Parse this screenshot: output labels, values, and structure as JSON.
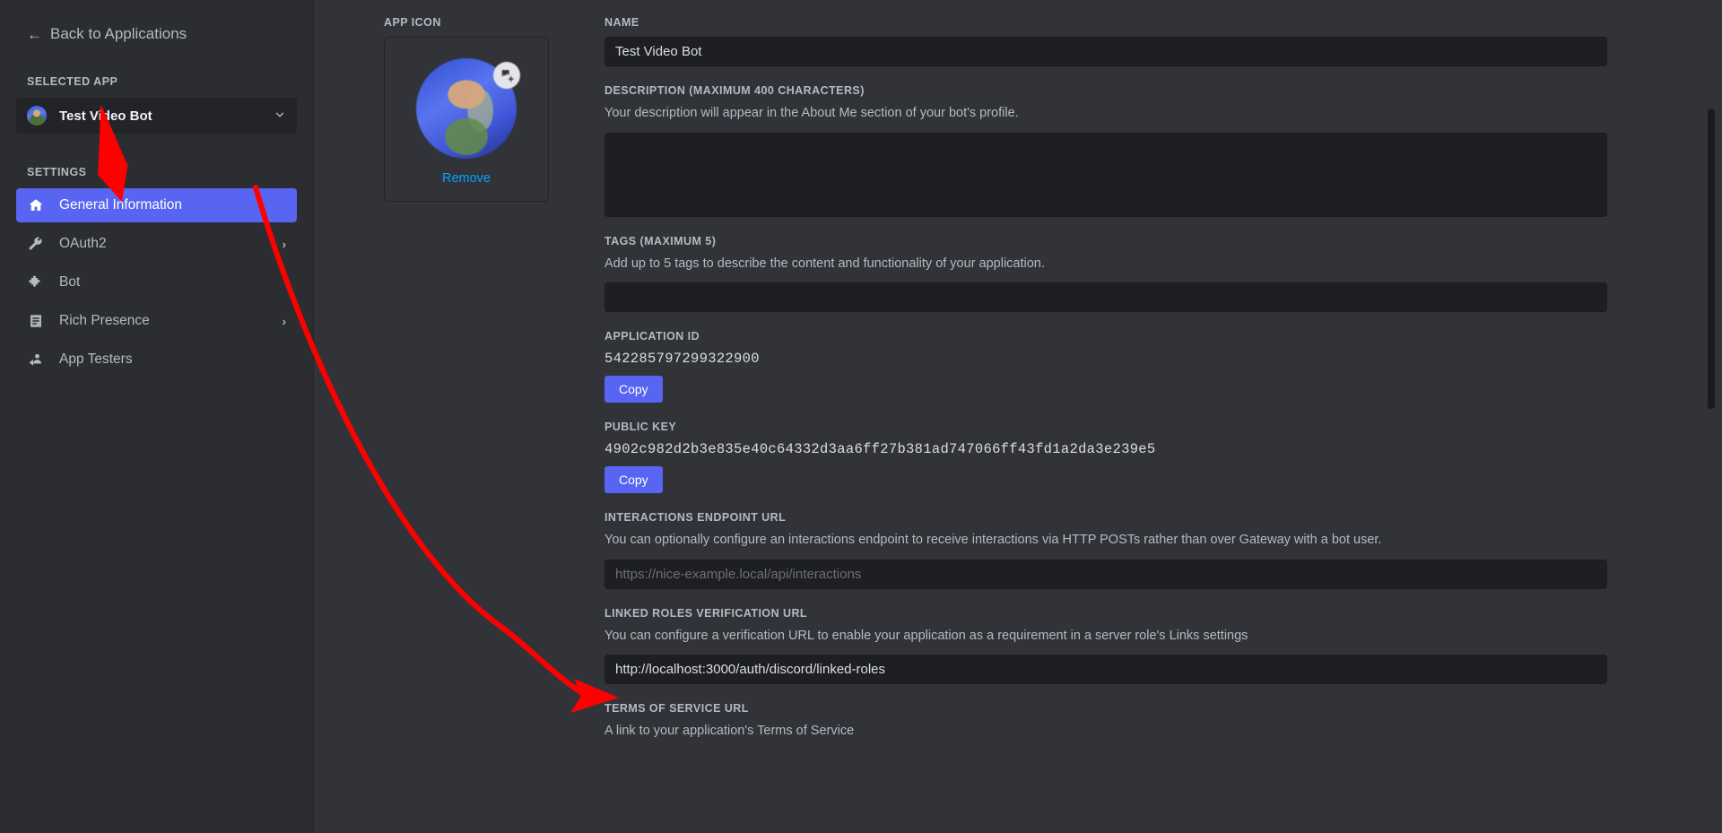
{
  "sidebar": {
    "back_label": "Back to Applications",
    "selected_app_heading": "SELECTED APP",
    "selected_app_name": "Test Video Bot",
    "settings_heading": "SETTINGS",
    "items": [
      {
        "label": "General Information",
        "icon": "home-icon",
        "active": true,
        "chevron": ""
      },
      {
        "label": "OAuth2",
        "icon": "wrench-icon",
        "active": false,
        "chevron": "›"
      },
      {
        "label": "Bot",
        "icon": "puzzle-icon",
        "active": false,
        "chevron": ""
      },
      {
        "label": "Rich Presence",
        "icon": "list-icon",
        "active": false,
        "chevron": "›"
      },
      {
        "label": "App Testers",
        "icon": "person-add-icon",
        "active": false,
        "chevron": ""
      }
    ]
  },
  "app_icon": {
    "label": "APP ICON",
    "remove_label": "Remove",
    "upload_icon": "image-add-icon"
  },
  "form": {
    "name": {
      "label": "NAME",
      "value": "Test Video Bot"
    },
    "description": {
      "label": "DESCRIPTION (MAXIMUM 400 CHARACTERS)",
      "help": "Your description will appear in the About Me section of your bot's profile.",
      "value": ""
    },
    "tags": {
      "label": "TAGS (MAXIMUM 5)",
      "help": "Add up to 5 tags to describe the content and functionality of your application.",
      "value": ""
    },
    "application_id": {
      "label": "APPLICATION ID",
      "value": "542285797299322900",
      "copy_label": "Copy"
    },
    "public_key": {
      "label": "PUBLIC KEY",
      "value": "4902c982d2b3e835e40c64332d3aa6ff27b381ad747066ff43fd1a2da3e239e5",
      "copy_label": "Copy"
    },
    "interactions_endpoint_url": {
      "label": "INTERACTIONS ENDPOINT URL",
      "help": "You can optionally configure an interactions endpoint to receive interactions via HTTP POSTs rather than over Gateway with a bot user.",
      "value": "",
      "placeholder": "https://nice-example.local/api/interactions"
    },
    "linked_roles_verification_url": {
      "label": "LINKED ROLES VERIFICATION URL",
      "help": "You can configure a verification URL to enable your application as a requirement in a server role's Links settings",
      "value": "http://localhost:3000/auth/discord/linked-roles"
    },
    "terms_of_service_url": {
      "label": "TERMS OF SERVICE URL",
      "help": "A link to your application's Terms of Service"
    }
  },
  "colors": {
    "accent": "#5865f2",
    "sidebar_bg": "#2b2d31",
    "main_bg": "#313338",
    "input_bg": "#1e1f22",
    "link": "#00a8fc",
    "annotation": "#ff0000",
    "text_muted": "#b5bac1"
  },
  "annotations": [
    {
      "name": "arrow-to-general-information",
      "type": "straight-arrow"
    },
    {
      "name": "arrow-to-linked-roles-url",
      "type": "curved-arrow"
    }
  ]
}
